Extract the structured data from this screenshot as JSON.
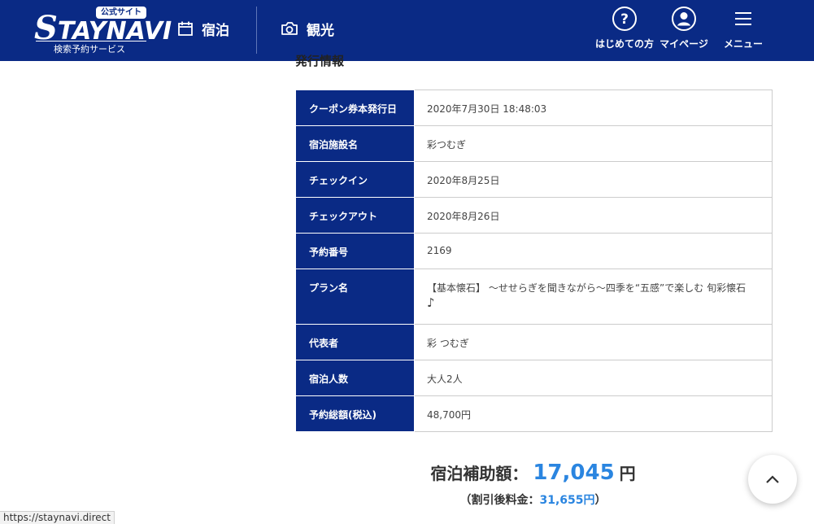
{
  "header": {
    "logo_badge": "公式サイト",
    "logo_text_initial": "S",
    "logo_text_rest": "TAYNAVI",
    "logo_sub": "検索予約サービス",
    "nav": [
      {
        "label": "宿泊",
        "icon": "calendar-icon"
      },
      {
        "label": "観光",
        "icon": "camera-icon"
      }
    ],
    "right": [
      {
        "label": "はじめての方",
        "icon": "question-circle-icon"
      },
      {
        "label": "マイページ",
        "icon": "user-circle-icon"
      },
      {
        "label": "メニュー",
        "icon": "hamburger-menu-icon"
      }
    ]
  },
  "section_title": "発行情報",
  "info_rows": [
    {
      "label": "クーポン券本発行日",
      "value": "2020年7月30日 18:48:03"
    },
    {
      "label": "宿泊施設名",
      "value": "彩つむぎ"
    },
    {
      "label": "チェックイン",
      "value": "2020年8月25日"
    },
    {
      "label": "チェックアウト",
      "value": "2020年8月26日"
    },
    {
      "label": "予約番号",
      "value": "2169"
    },
    {
      "label": "プラン名",
      "value": "【基本懐石】 〜せせらぎを聞きながら〜四季を“五感”で楽しむ 旬彩懐石",
      "value2": "♪"
    },
    {
      "label": "代表者",
      "value": "彩 つむぎ"
    },
    {
      "label": "宿泊人数",
      "value": "大人2人"
    },
    {
      "label": "予約総額(税込)",
      "value": "48,700円"
    }
  ],
  "subsidy": {
    "label": "宿泊補助額：",
    "amount": "17,045",
    "unit": "円",
    "after_prefix": "（割引後料金：",
    "after_amount": "31,655円",
    "after_suffix": "）"
  },
  "status_url": "https://staynavi.direct"
}
